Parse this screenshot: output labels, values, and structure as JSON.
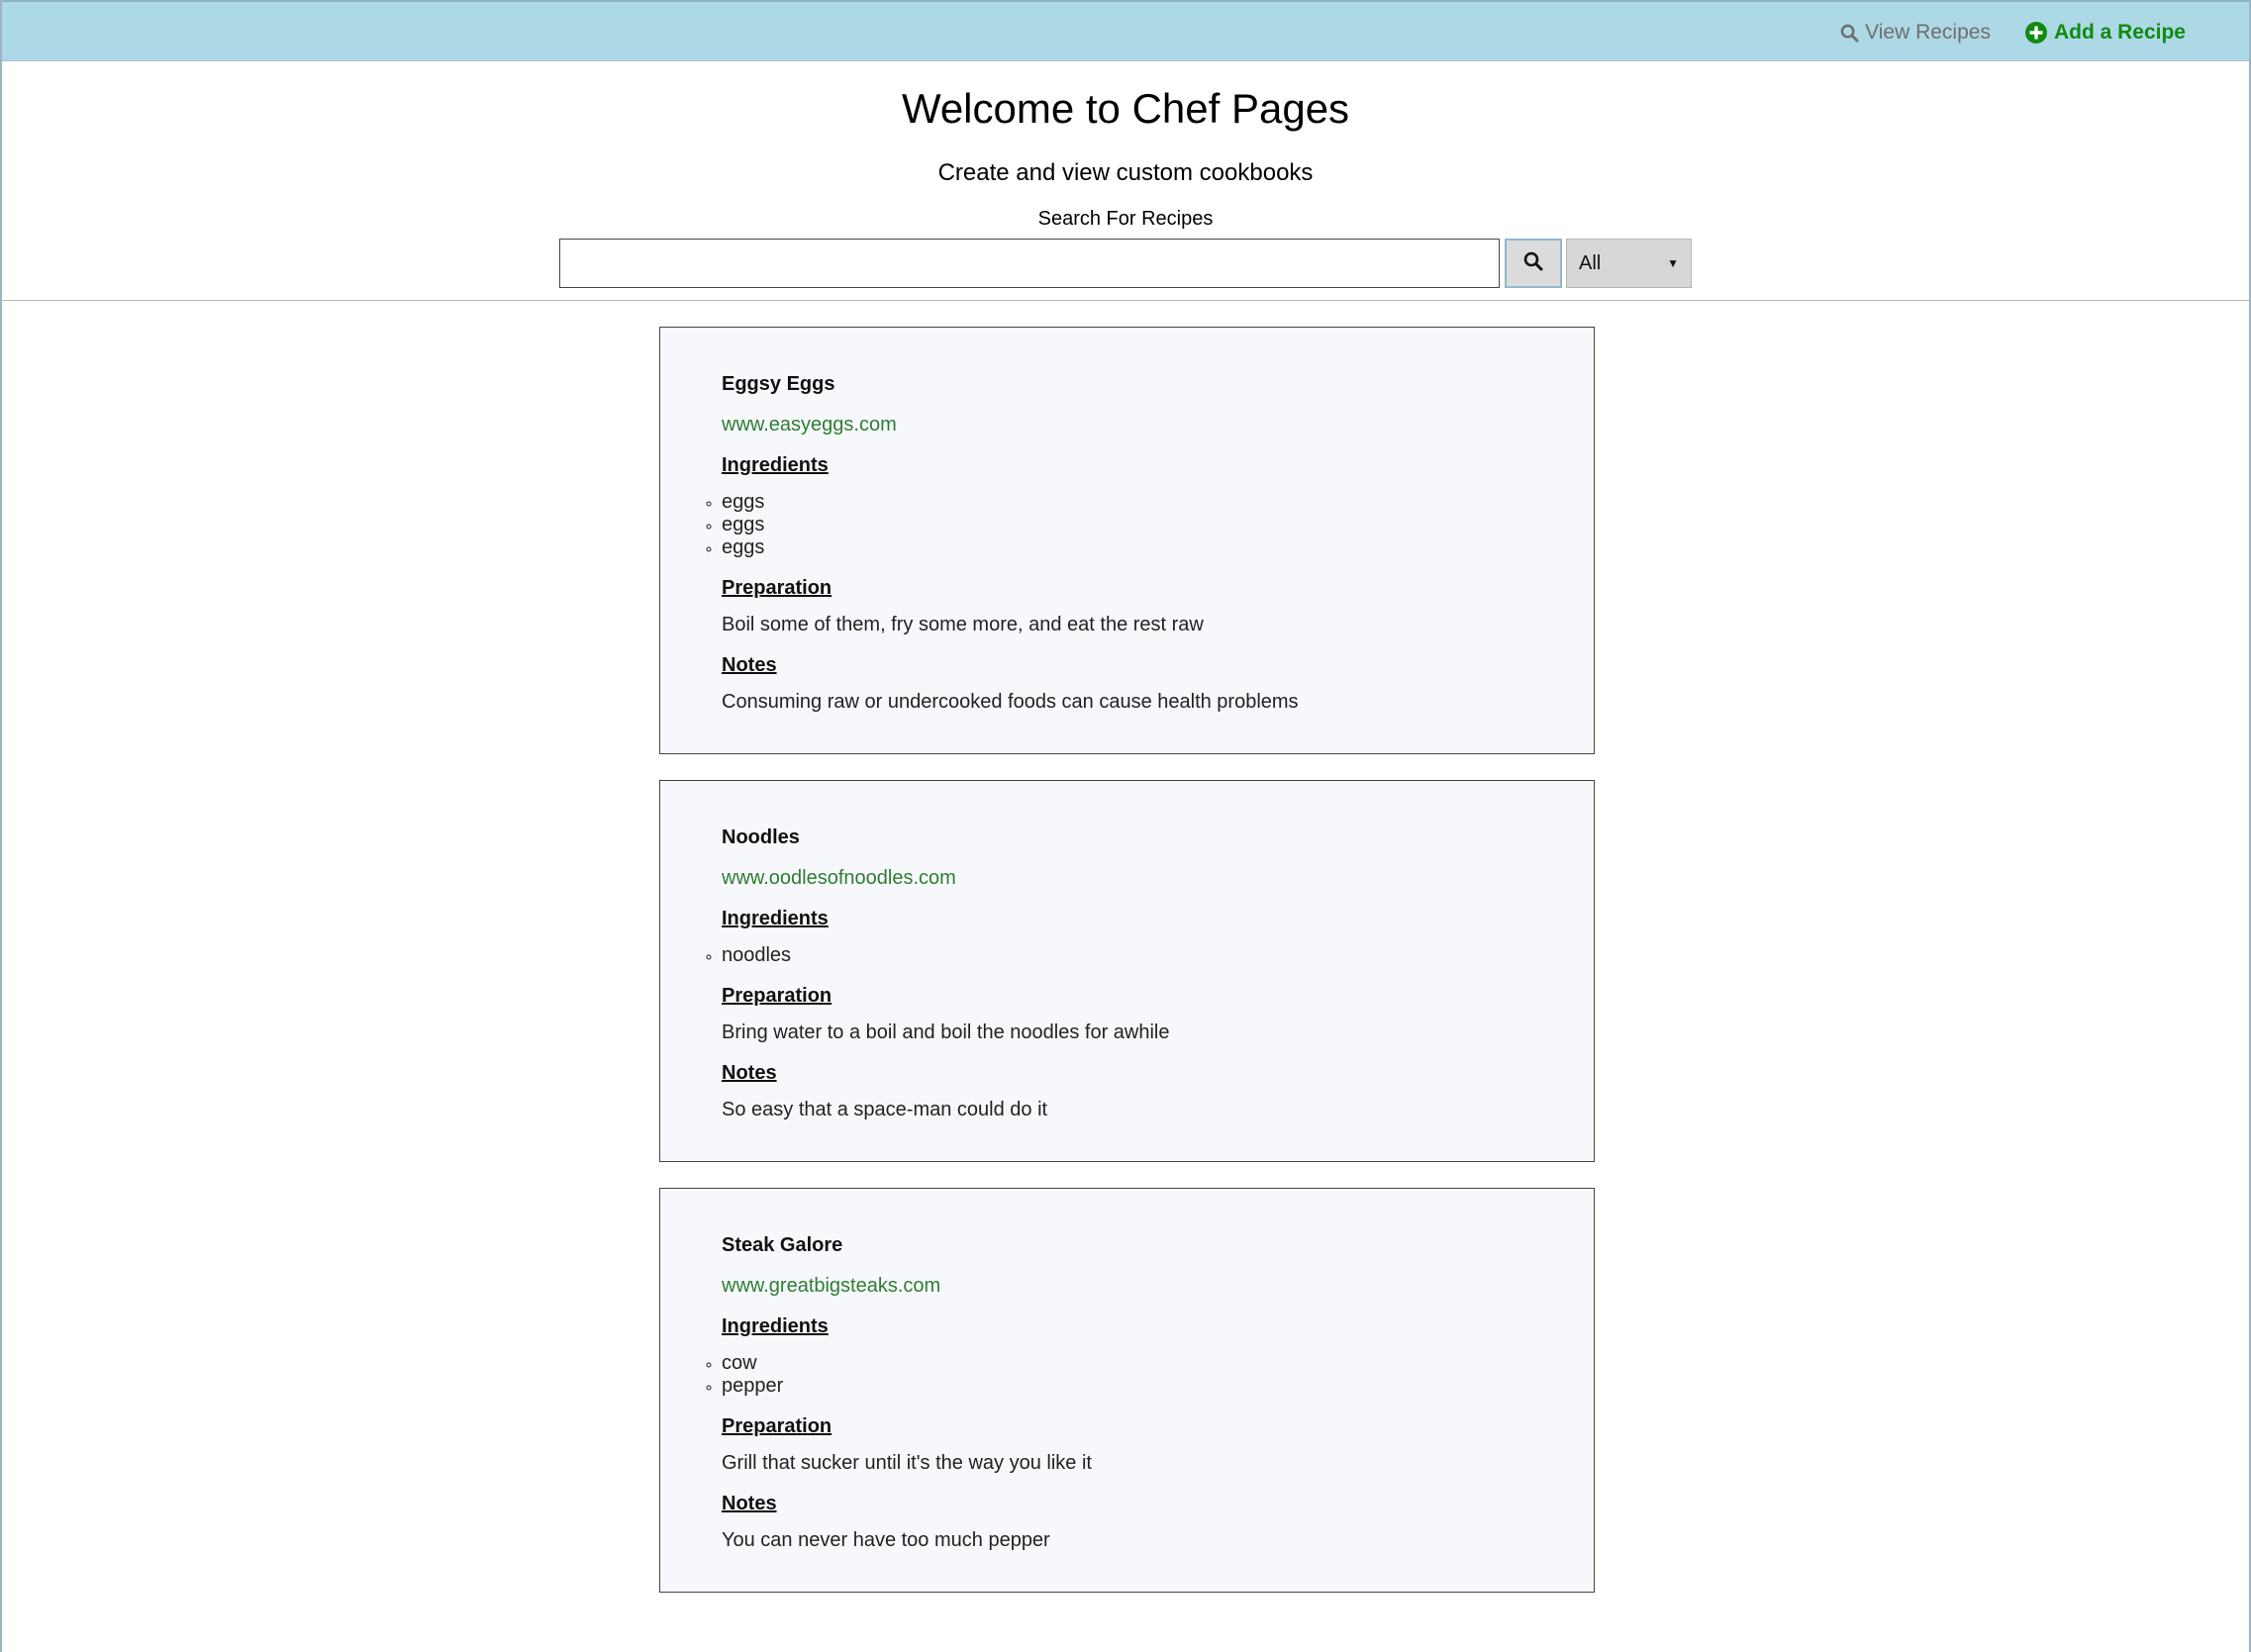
{
  "nav": {
    "view_recipes": "View Recipes",
    "add_recipe": "Add a Recipe"
  },
  "header": {
    "title": "Welcome to Chef Pages",
    "subtitle": "Create and view custom cookbooks",
    "search_label": "Search For Recipes",
    "search_value": "",
    "filter_selected": "All"
  },
  "labels": {
    "ingredients": "Ingredients",
    "preparation": "Preparation",
    "notes": "Notes"
  },
  "recipes": [
    {
      "name": "Eggsy Eggs",
      "url": "www.easyeggs.com",
      "ingredients": [
        "eggs",
        "eggs",
        "eggs"
      ],
      "preparation": "Boil some of them, fry some more, and eat the rest raw",
      "notes": "Consuming raw or undercooked foods can cause health problems"
    },
    {
      "name": "Noodles",
      "url": "www.oodlesofnoodles.com",
      "ingredients": [
        "noodles"
      ],
      "preparation": "Bring water to a boil and boil the noodles for awhile",
      "notes": "So easy that a space-man could do it"
    },
    {
      "name": "Steak Galore",
      "url": "www.greatbigsteaks.com",
      "ingredients": [
        "cow",
        "pepper"
      ],
      "preparation": "Grill that sucker until it's the way you like it",
      "notes": "You can never have too much pepper"
    }
  ],
  "colors": {
    "topbar": "#add8e6",
    "link_green": "#2e7d32",
    "add_green": "#108a10",
    "card_bg": "#f7f8fc"
  },
  "icons": {
    "view": "search-icon",
    "add": "plus-circle-icon",
    "search_button": "search-icon",
    "select": "caret-down-icon"
  }
}
